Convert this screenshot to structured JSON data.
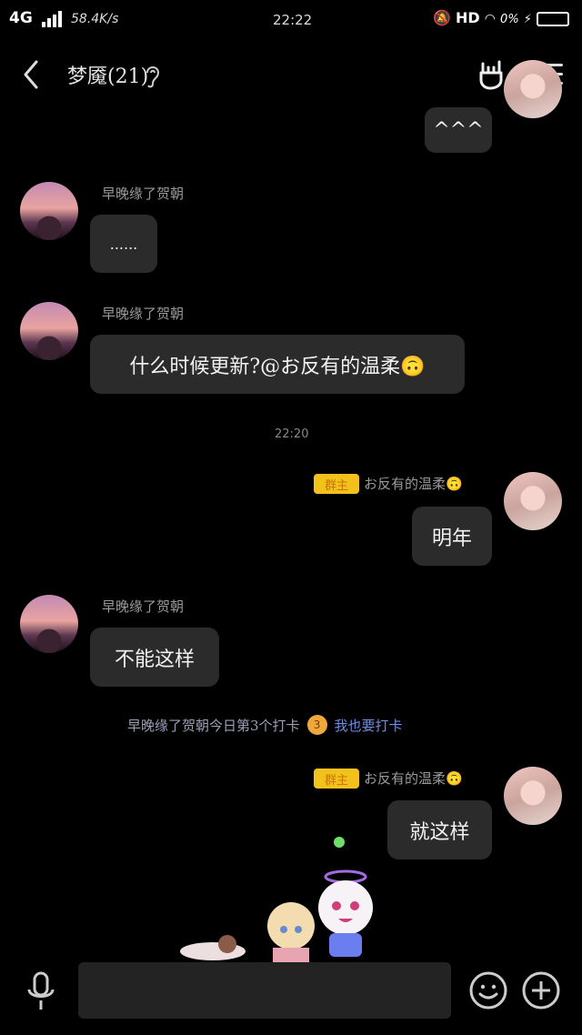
{
  "status_bar": {
    "network": "4G",
    "speed": "58.4K/s",
    "time": "22:22",
    "hd": "HD",
    "battery": "0%"
  },
  "nav": {
    "title": "梦魇(21)",
    "back_icon": "chevron-left-icon",
    "ear_icon": "ear-icon",
    "hand_icon": "rock-hand-icon",
    "menu_icon": "hamburger-menu-icon"
  },
  "messages": [
    {
      "side": "right",
      "text": "^^^"
    },
    {
      "side": "left",
      "name": "早晚缘了贺朝",
      "text": "......"
    },
    {
      "side": "left",
      "name": "早晚缘了贺朝",
      "text": "什么时候更新?@お反有的温柔🙃"
    },
    {
      "type": "time",
      "text": "22:20"
    },
    {
      "side": "right",
      "badge": "群主",
      "name": "お反有的温柔🙃",
      "text": "明年"
    },
    {
      "side": "left",
      "name": "早晚缘了贺朝",
      "text": "不能这样"
    },
    {
      "type": "system",
      "text": "早晚缘了贺朝今日第3个打卡",
      "rank": "3",
      "link": "我也要打卡"
    },
    {
      "side": "right",
      "badge": "群主",
      "name": "お反有的温柔🙃",
      "text": "就这样"
    }
  ],
  "bottom": {
    "mic_icon": "microphone-icon",
    "emoji_icon": "smiley-icon",
    "plus_icon": "plus-circle-icon",
    "input_placeholder": ""
  },
  "colors": {
    "background": "#000000",
    "bubble": "#2b2b2b",
    "badge": "#f2c11c",
    "link": "#6f8fe0"
  }
}
